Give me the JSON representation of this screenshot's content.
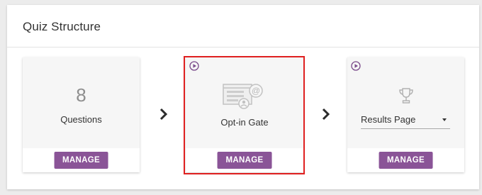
{
  "panel": {
    "title": "Quiz Structure"
  },
  "cards": {
    "questions": {
      "count": "8",
      "label": "Questions",
      "button": "MANAGE"
    },
    "optin": {
      "label": "Opt-in Gate",
      "button": "MANAGE",
      "icon": "opt-in-form-icon",
      "badge_icon": "play-circle-icon",
      "selected": true
    },
    "results": {
      "select_value": "Results Page",
      "button": "MANAGE",
      "icon": "trophy-icon",
      "badge_icon": "play-circle-icon"
    }
  },
  "arrows": [
    "chevron-right-icon",
    "chevron-right-icon"
  ],
  "colors": {
    "accent": "#8a5497",
    "selection": "#e02020",
    "card_bg": "#f6f6f6"
  }
}
